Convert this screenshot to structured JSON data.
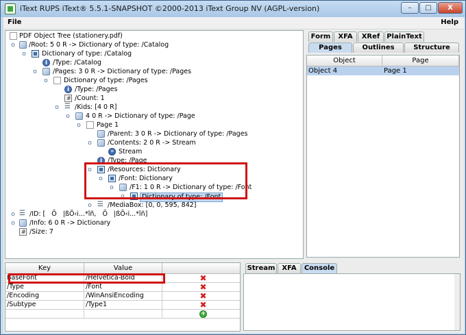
{
  "window": {
    "title": "iText RUPS iText® 5.5.1-SNAPSHOT ©2000-2013 iText Group NV (AGPL-version)",
    "minimize": "–",
    "maximize": "□",
    "close": "X"
  },
  "menu": {
    "file": "File",
    "help": "Help"
  },
  "tree": {
    "rows": [
      {
        "label": "PDF Object Tree (stationery.pdf)"
      },
      {
        "label": "/Root: 5 0 R -> Dictionary of type: /Catalog"
      },
      {
        "label": "Dictionary of type: /Catalog"
      },
      {
        "label": "/Type: /Catalog"
      },
      {
        "label": "/Pages: 3 0 R -> Dictionary of type: /Pages"
      },
      {
        "label": "Dictionary of type: /Pages"
      },
      {
        "label": "/Type: /Pages"
      },
      {
        "label": "/Count: 1"
      },
      {
        "label": "/Kids: [4 0 R]"
      },
      {
        "label": "4 0 R -> Dictionary of type: /Page"
      },
      {
        "label": "Page 1"
      },
      {
        "label": "/Parent: 3 0 R -> Dictionary of type: /Pages"
      },
      {
        "label": "/Contents: 2 0 R -> Stream"
      },
      {
        "label": "Stream"
      },
      {
        "label": "/Type: /Page"
      },
      {
        "label": "/Resources: Dictionary"
      },
      {
        "label": "/Font: Dictionary"
      },
      {
        "label": "/F1: 1 0 R -> Dictionary of type: /Font"
      },
      {
        "label": "Dictionary of type: /Font"
      },
      {
        "label": "/MediaBox: [0, 0, 595, 842]"
      },
      {
        "label": "/ID: [    Õ    |ßÕ‹i...*îñ,    Õ    |ßÕ‹i...*îñ]"
      },
      {
        "label": "/Info: 6 0 R -> Dictionary"
      },
      {
        "label": "/Size: 7"
      }
    ]
  },
  "right_tabs": {
    "top": [
      "Form",
      "XFA",
      "XRef",
      "PlainText"
    ],
    "bottom": [
      "Pages",
      "Outlines",
      "Structure"
    ]
  },
  "pages_table": {
    "headers": [
      "Object",
      "Page"
    ],
    "rows": [
      [
        "Object 4",
        "Page 1"
      ]
    ]
  },
  "kv_table": {
    "headers": [
      "Key",
      "Value"
    ],
    "rows": [
      [
        "BaseFont",
        "/Helvetica-Bold"
      ],
      [
        "/Type",
        "/Font"
      ],
      [
        "/Encoding",
        "/WinAnsiEncoding"
      ],
      [
        "/Subtype",
        "/Type1"
      ]
    ]
  },
  "bottom_tabs": [
    "Stream",
    "XFA",
    "Console"
  ],
  "colors": {
    "selection": "#c3d7ef",
    "highlight": "#d01010",
    "delete": "#d42020",
    "add": "#3fae3f"
  }
}
